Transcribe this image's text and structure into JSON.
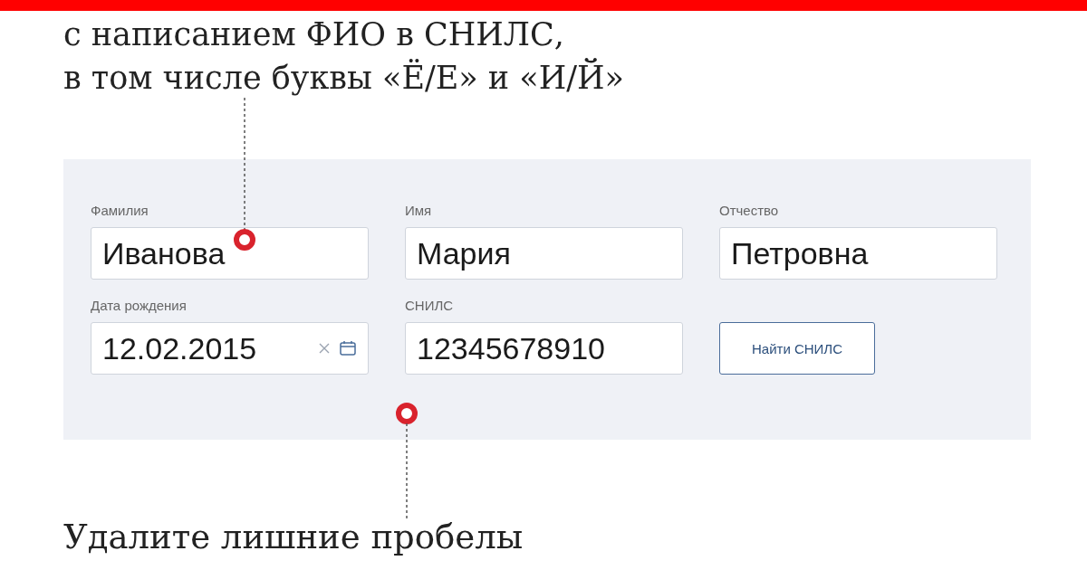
{
  "heading": [
    "с написанием ФИО в СНИЛС,",
    "в том числе буквы «Ё/Е» и «И/Й»"
  ],
  "form": {
    "fields": [
      {
        "kind": "text",
        "label": "Фамилия",
        "value": "Иванова"
      },
      {
        "kind": "text",
        "label": "Имя",
        "value": "Мария"
      },
      {
        "kind": "text",
        "label": "Отчество",
        "value": "Петровна"
      },
      {
        "kind": "date",
        "label": "Дата рождения",
        "value": "12.02.2015"
      },
      {
        "kind": "text",
        "label": "СНИЛС",
        "value": "12345678910"
      },
      {
        "kind": "button",
        "label": "Найти СНИЛС"
      }
    ]
  },
  "caption": "Удалите лишние пробелы"
}
